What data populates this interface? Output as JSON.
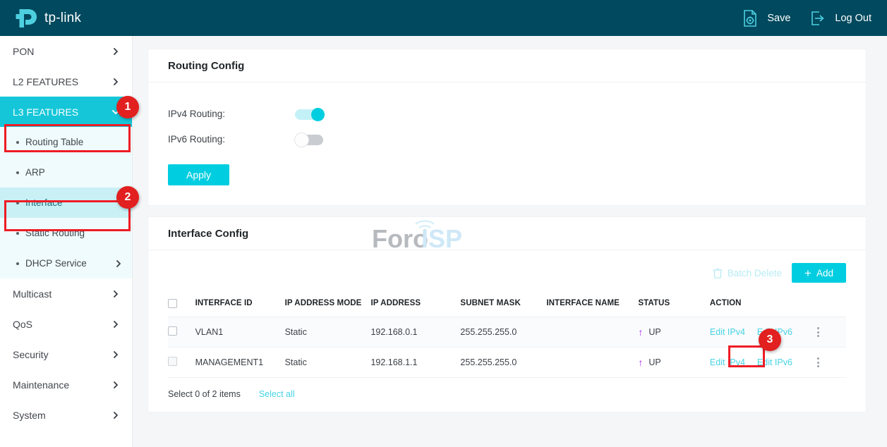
{
  "header": {
    "brand": "tp-link",
    "save_label": "Save",
    "logout_label": "Log Out",
    "save_icon": "save-document-gear-icon",
    "logout_icon": "logout-arrow-icon",
    "bg_color": "#00495e"
  },
  "sidebar": {
    "items": [
      {
        "label": "PON",
        "type": "group",
        "expandable": true
      },
      {
        "label": "L2 FEATURES",
        "type": "group",
        "expandable": true
      },
      {
        "label": "L3 FEATURES",
        "type": "group",
        "expandable": true,
        "active": true
      }
    ],
    "sub_items": [
      {
        "label": "Routing Table",
        "expandable": false
      },
      {
        "label": "ARP",
        "expandable": false
      },
      {
        "label": "Interface",
        "expandable": false,
        "selected": true
      },
      {
        "label": "Static Routing",
        "expandable": false
      },
      {
        "label": "DHCP Service",
        "expandable": true
      }
    ],
    "items_after": [
      {
        "label": "Multicast",
        "expandable": true
      },
      {
        "label": "QoS",
        "expandable": true
      },
      {
        "label": "Security",
        "expandable": true
      },
      {
        "label": "Maintenance",
        "expandable": true
      },
      {
        "label": "System",
        "expandable": true
      }
    ],
    "active_color": "#15c6d9",
    "selected_color": "#c9f0f5"
  },
  "routing_config": {
    "title": "Routing Config",
    "ipv4_label": "IPv4 Routing:",
    "ipv4_enabled": true,
    "ipv6_label": "IPv6 Routing:",
    "ipv6_enabled": false,
    "apply_label": "Apply"
  },
  "interface_config": {
    "title": "Interface Config",
    "batch_delete_label": "Batch Delete",
    "add_label": "Add",
    "columns": [
      "INTERFACE ID",
      "IP ADDRESS MODE",
      "IP ADDRESS",
      "SUBNET MASK",
      "INTERFACE NAME",
      "STATUS",
      "ACTION"
    ],
    "rows": [
      {
        "interface_id": "VLAN1",
        "mode": "Static",
        "ip_address": "192.168.0.1",
        "subnet_mask": "255.255.255.0",
        "interface_name": "",
        "status": "UP",
        "edit_ipv4": "Edit IPv4",
        "edit_ipv6": "Edit IPv6"
      },
      {
        "interface_id": "MANAGEMENT1",
        "mode": "Static",
        "ip_address": "192.168.1.1",
        "subnet_mask": "255.255.255.0",
        "interface_name": "",
        "status": "UP",
        "edit_ipv4": "Edit IPv4",
        "edit_ipv6": "Edit IPv6"
      }
    ],
    "footer_text": "Select 0 of 2 items",
    "select_all_label": "Select all",
    "status_arrow_color": "#ae22f0",
    "link_color": "#46d3e4"
  },
  "watermark": {
    "text_part1": "Foro",
    "text_part2": "ISP"
  },
  "annotations": {
    "badge1": "1",
    "badge2": "2",
    "badge3": "3",
    "color": "#e1201f"
  }
}
